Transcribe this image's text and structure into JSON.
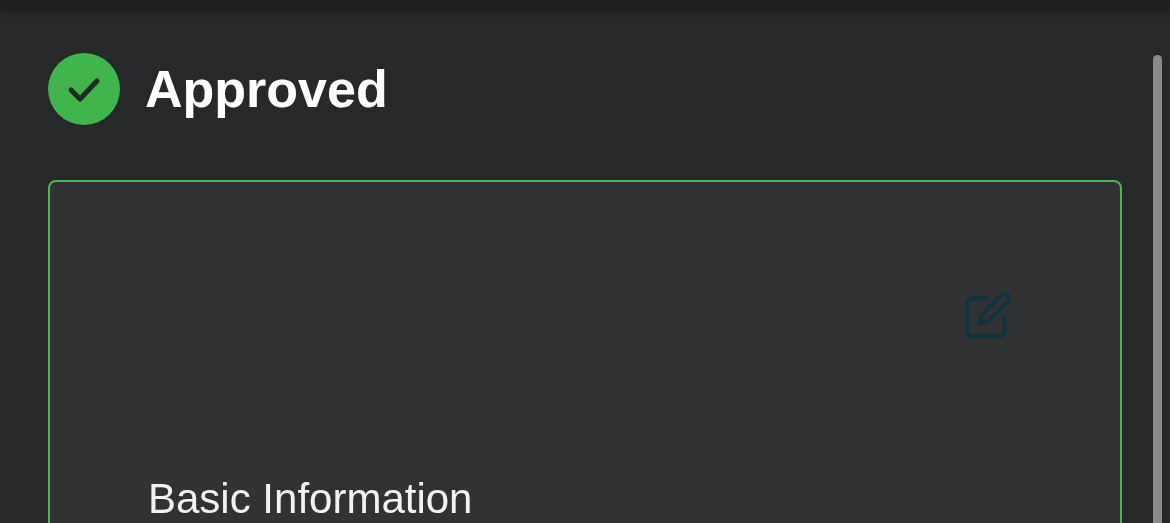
{
  "status": {
    "label": "Approved",
    "approved": true
  },
  "card": {
    "title": "Basic Information"
  }
}
